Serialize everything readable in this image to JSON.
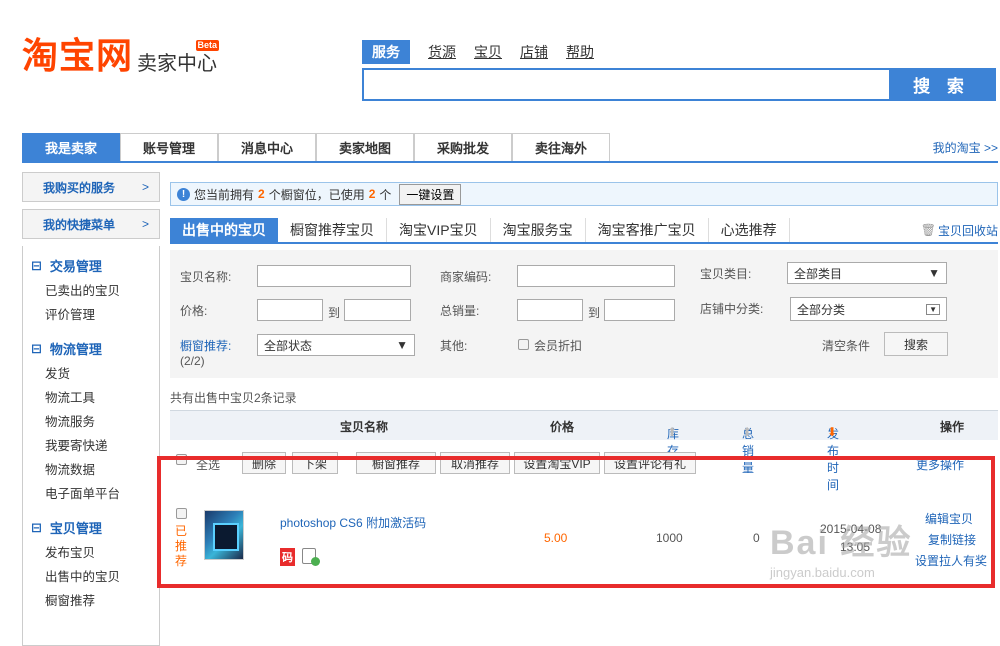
{
  "logo": {
    "main": "淘宝网",
    "sub": "卖家中心",
    "beta": "Beta"
  },
  "search_nav": {
    "tabs": [
      "服务",
      "货源",
      "宝贝",
      "店铺",
      "帮助"
    ],
    "active": "服务",
    "button": "搜 索"
  },
  "main_nav": {
    "tabs": [
      "我是卖家",
      "账号管理",
      "消息中心",
      "卖家地图",
      "采购批发",
      "卖往海外"
    ],
    "my_taobao": "我的淘宝 >>"
  },
  "sidebar": {
    "boxes": [
      {
        "label": "我购买的服务",
        "arrow": ">"
      },
      {
        "label": "我的快捷菜单",
        "arrow": ">"
      }
    ],
    "groups": [
      {
        "title": "交易管理",
        "items": [
          "已卖出的宝贝",
          "评价管理"
        ]
      },
      {
        "title": "物流管理",
        "items": [
          "发货",
          "物流工具",
          "物流服务",
          "我要寄快递",
          "物流数据",
          "电子面单平台"
        ]
      },
      {
        "title": "宝贝管理",
        "items": [
          "发布宝贝",
          "出售中的宝贝",
          "橱窗推荐"
        ]
      }
    ],
    "collapse": "⊟"
  },
  "notice": {
    "pre": "您当前拥有",
    "count1": "2",
    "mid": "个橱窗位，已使用",
    "count2": "2",
    "post": "个",
    "button": "一键设置"
  },
  "subtabs": {
    "items": [
      "出售中的宝贝",
      "橱窗推荐宝贝",
      "淘宝VIP宝贝",
      "淘宝服务宝",
      "淘宝客推广宝贝",
      "心选推荐"
    ],
    "recycle": "宝贝回收站"
  },
  "filter": {
    "name_label": "宝贝名称:",
    "code_label": "商家编码:",
    "category_label": "宝贝类目:",
    "category_value": "全部类目",
    "price_label": "价格:",
    "to1": "到",
    "sales_label": "总销量:",
    "to2": "到",
    "shop_cat_label": "店铺中分类:",
    "shop_cat_value": "全部分类",
    "window_label": "橱窗推荐:",
    "window_count": "(2/2)",
    "window_value": "全部状态",
    "other_label": "其他:",
    "member_discount": "会员折扣",
    "clear": "清空条件",
    "search": "搜索"
  },
  "summary": "共有出售中宝贝2条记录",
  "table": {
    "headers": {
      "name": "宝贝名称",
      "price": "价格",
      "stock": "库存",
      "sales": "总销量",
      "time": "发布时间",
      "ops": "操作"
    }
  },
  "bulk": {
    "select_all": "全选",
    "buttons": [
      "删除",
      "下架",
      "橱窗推荐",
      "取消推荐",
      "设置淘宝VIP",
      "设置评论有礼"
    ],
    "more": "更多操作"
  },
  "row": {
    "status": [
      "已",
      "推",
      "荐"
    ],
    "title": "photoshop CS6 附加激活码",
    "code_badge": "码",
    "price": "5.00",
    "stock": "1000",
    "sales": "0",
    "date": "2015-04-08",
    "time": "13:05",
    "ops": [
      "编辑宝贝",
      "复制链接",
      "设置拉人有奖"
    ]
  },
  "watermark": {
    "main": "Bai 经验",
    "sub": "jingyan.baidu.com"
  },
  "colors": {
    "brand": "#ff4400",
    "accent": "#3d83d6",
    "highlight": "#e82c2c",
    "link": "#1f65b8",
    "price": "#ff6600"
  }
}
